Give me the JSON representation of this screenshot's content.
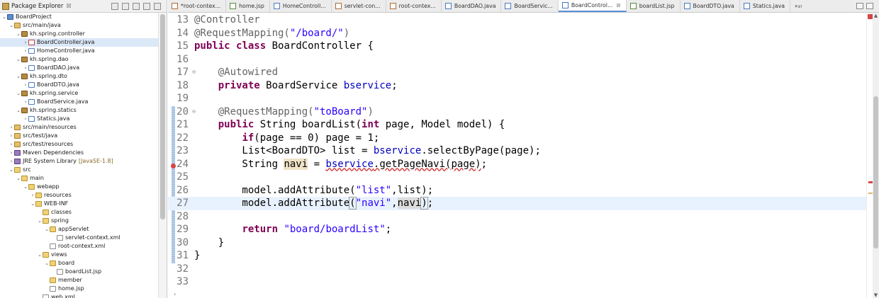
{
  "explorer": {
    "title": "Package Explorer",
    "close": "☒",
    "items": [
      {
        "label": "BoardProject",
        "icon": "project-icon",
        "depth": 0,
        "twisty": "⌄"
      },
      {
        "label": "src/main/java",
        "icon": "source-folder-icon",
        "depth": 1,
        "twisty": "⌄"
      },
      {
        "label": "kh.spring.controller",
        "icon": "package-icon",
        "depth": 2,
        "twisty": "⌄"
      },
      {
        "label": "BoardController.java",
        "icon": "java-file-error-icon",
        "depth": 3,
        "twisty": "›",
        "selected": true
      },
      {
        "label": "HomeController.java",
        "icon": "java-file-icon",
        "depth": 3,
        "twisty": "›"
      },
      {
        "label": "kh.spring.dao",
        "icon": "package-icon",
        "depth": 2,
        "twisty": "⌄"
      },
      {
        "label": "BoardDAO.java",
        "icon": "java-file-icon",
        "depth": 3,
        "twisty": "›"
      },
      {
        "label": "kh.spring.dto",
        "icon": "package-icon",
        "depth": 2,
        "twisty": "⌄"
      },
      {
        "label": "BoardDTO.java",
        "icon": "java-file-icon",
        "depth": 3,
        "twisty": "›"
      },
      {
        "label": "kh.spring.service",
        "icon": "package-icon",
        "depth": 2,
        "twisty": "⌄"
      },
      {
        "label": "BoardService.java",
        "icon": "java-file-icon",
        "depth": 3,
        "twisty": "›"
      },
      {
        "label": "kh.spring.statics",
        "icon": "package-icon",
        "depth": 2,
        "twisty": "⌄"
      },
      {
        "label": "Statics.java",
        "icon": "java-file-icon",
        "depth": 3,
        "twisty": "›"
      },
      {
        "label": "src/main/resources",
        "icon": "source-folder-icon",
        "depth": 1,
        "twisty": "›"
      },
      {
        "label": "src/test/java",
        "icon": "source-folder-icon",
        "depth": 1,
        "twisty": "›"
      },
      {
        "label": "src/test/resources",
        "icon": "source-folder-icon",
        "depth": 1,
        "twisty": "›"
      },
      {
        "label": "Maven Dependencies",
        "icon": "library-icon",
        "depth": 1,
        "twisty": "›"
      },
      {
        "label": "JRE System Library",
        "sub": "[JavaSE-1.8]",
        "icon": "library-icon",
        "depth": 1,
        "twisty": "›"
      },
      {
        "label": "src",
        "icon": "folder-icon",
        "depth": 1,
        "twisty": "⌄"
      },
      {
        "label": "main",
        "icon": "folder-icon",
        "depth": 2,
        "twisty": "⌄"
      },
      {
        "label": "webapp",
        "icon": "folder-icon",
        "depth": 3,
        "twisty": "⌄"
      },
      {
        "label": "resources",
        "icon": "folder-icon",
        "depth": 4,
        "twisty": "›"
      },
      {
        "label": "WEB-INF",
        "icon": "folder-icon",
        "depth": 4,
        "twisty": "⌄"
      },
      {
        "label": "classes",
        "icon": "folder-icon",
        "depth": 5,
        "twisty": ""
      },
      {
        "label": "spring",
        "icon": "folder-icon",
        "depth": 5,
        "twisty": "⌄"
      },
      {
        "label": "appServlet",
        "icon": "folder-icon",
        "depth": 6,
        "twisty": "⌄"
      },
      {
        "label": "servlet-context.xml",
        "icon": "xml-file-icon",
        "depth": 7,
        "twisty": ""
      },
      {
        "label": "root-context.xml",
        "icon": "xml-file-icon",
        "depth": 6,
        "twisty": ""
      },
      {
        "label": "views",
        "icon": "folder-icon",
        "depth": 5,
        "twisty": "⌄"
      },
      {
        "label": "board",
        "icon": "folder-icon",
        "depth": 6,
        "twisty": "⌄"
      },
      {
        "label": "boardList.jsp",
        "icon": "jsp-file-icon",
        "depth": 7,
        "twisty": ""
      },
      {
        "label": "member",
        "icon": "folder-icon",
        "depth": 6,
        "twisty": ""
      },
      {
        "label": "home.jsp",
        "icon": "jsp-file-icon",
        "depth": 6,
        "twisty": ""
      },
      {
        "label": "web.xml",
        "icon": "xml-file-icon",
        "depth": 5,
        "twisty": ""
      }
    ]
  },
  "tabs": [
    {
      "label": "*root-contex...",
      "icon": "xml-file-icon"
    },
    {
      "label": "home.jsp",
      "icon": "jsp-file-icon"
    },
    {
      "label": "HomeControll...",
      "icon": "java-file-icon"
    },
    {
      "label": "servlet-con...",
      "icon": "xml-file-icon"
    },
    {
      "label": "root-contex...",
      "icon": "xml-file-icon"
    },
    {
      "label": "BoardDAO.java",
      "icon": "java-file-icon"
    },
    {
      "label": "BoardServic...",
      "icon": "java-file-icon"
    },
    {
      "label": "BoardControl...",
      "icon": "java-file-icon",
      "active": true,
      "close": "☒"
    },
    {
      "label": "boardList.jsp",
      "icon": "jsp-file-icon"
    },
    {
      "label": "BoardDTO.java",
      "icon": "java-file-icon"
    },
    {
      "label": "Statics.java",
      "icon": "java-file-icon"
    }
  ],
  "tab_overflow": "»₃₇",
  "code": {
    "lines": [
      {
        "n": "13",
        "segs": [
          [
            "ann",
            "@Controller"
          ]
        ]
      },
      {
        "n": "14",
        "segs": [
          [
            "ann",
            "@RequestMapping("
          ],
          [
            "str",
            "\"/board/\""
          ],
          [
            "ann",
            ")"
          ]
        ]
      },
      {
        "n": "15",
        "segs": [
          [
            "kw",
            "public"
          ],
          [
            "",
            " "
          ],
          [
            "kw",
            "class"
          ],
          [
            "",
            " BoardController {"
          ]
        ]
      },
      {
        "n": "16",
        "segs": []
      },
      {
        "n": "17",
        "fold": "⊖",
        "segs": [
          [
            "",
            "    "
          ],
          [
            "ann",
            "@Autowired"
          ]
        ]
      },
      {
        "n": "18",
        "segs": [
          [
            "",
            "    "
          ],
          [
            "kw",
            "private"
          ],
          [
            "",
            " BoardService "
          ],
          [
            "fld",
            "bservice"
          ],
          [
            "",
            ";"
          ]
        ]
      },
      {
        "n": "19",
        "segs": []
      },
      {
        "n": "20",
        "fold": "⊖",
        "segs": [
          [
            "",
            "    "
          ],
          [
            "ann",
            "@RequestMapping("
          ],
          [
            "str",
            "\"toBoard\""
          ],
          [
            "ann",
            ")"
          ]
        ]
      },
      {
        "n": "21",
        "segs": [
          [
            "",
            "    "
          ],
          [
            "kw",
            "public"
          ],
          [
            "",
            " String boardList("
          ],
          [
            "kw",
            "int"
          ],
          [
            "",
            " page, Model model) {"
          ]
        ]
      },
      {
        "n": "22",
        "segs": [
          [
            "",
            "        "
          ],
          [
            "kw",
            "if"
          ],
          [
            "",
            "(page == 0) page = 1;"
          ]
        ]
      },
      {
        "n": "23",
        "segs": [
          [
            "",
            "        List<BoardDTO> list = "
          ],
          [
            "fld",
            "bservice"
          ],
          [
            "",
            ".selectByPage(page);"
          ]
        ]
      },
      {
        "n": "24",
        "segs": [
          [
            "",
            "        String "
          ],
          [
            "occ",
            "navi"
          ],
          [
            "",
            " = "
          ],
          [
            "fld sq",
            "bservice"
          ],
          [
            "sq",
            ".getPageNavi(page)"
          ],
          [
            "",
            ";"
          ]
        ]
      },
      {
        "n": "25",
        "segs": []
      },
      {
        "n": "26",
        "segs": [
          [
            "",
            "        model.addAttribute("
          ],
          [
            "str",
            "\"list\""
          ],
          [
            "",
            ",list);"
          ]
        ]
      },
      {
        "n": "27",
        "current": true,
        "segs": [
          [
            "",
            "        model.addAttribute"
          ],
          [
            "caret-box",
            "("
          ],
          [
            "str",
            "\"navi\""
          ],
          [
            "",
            ","
          ],
          [
            "occ2",
            "navi"
          ],
          [
            "caret-box",
            ")"
          ],
          [
            "",
            ";"
          ]
        ]
      },
      {
        "n": "28",
        "segs": []
      },
      {
        "n": "29",
        "segs": [
          [
            "",
            "        "
          ],
          [
            "kw",
            "return"
          ],
          [
            "",
            " "
          ],
          [
            "str",
            "\"board/boardList\""
          ],
          [
            "",
            ";"
          ]
        ]
      },
      {
        "n": "30",
        "segs": [
          [
            "",
            "    }"
          ]
        ]
      },
      {
        "n": "31",
        "segs": [
          [
            "",
            "}"
          ]
        ]
      },
      {
        "n": "32",
        "segs": []
      },
      {
        "n": "33",
        "segs": []
      }
    ]
  },
  "scroll_hint": "‹"
}
